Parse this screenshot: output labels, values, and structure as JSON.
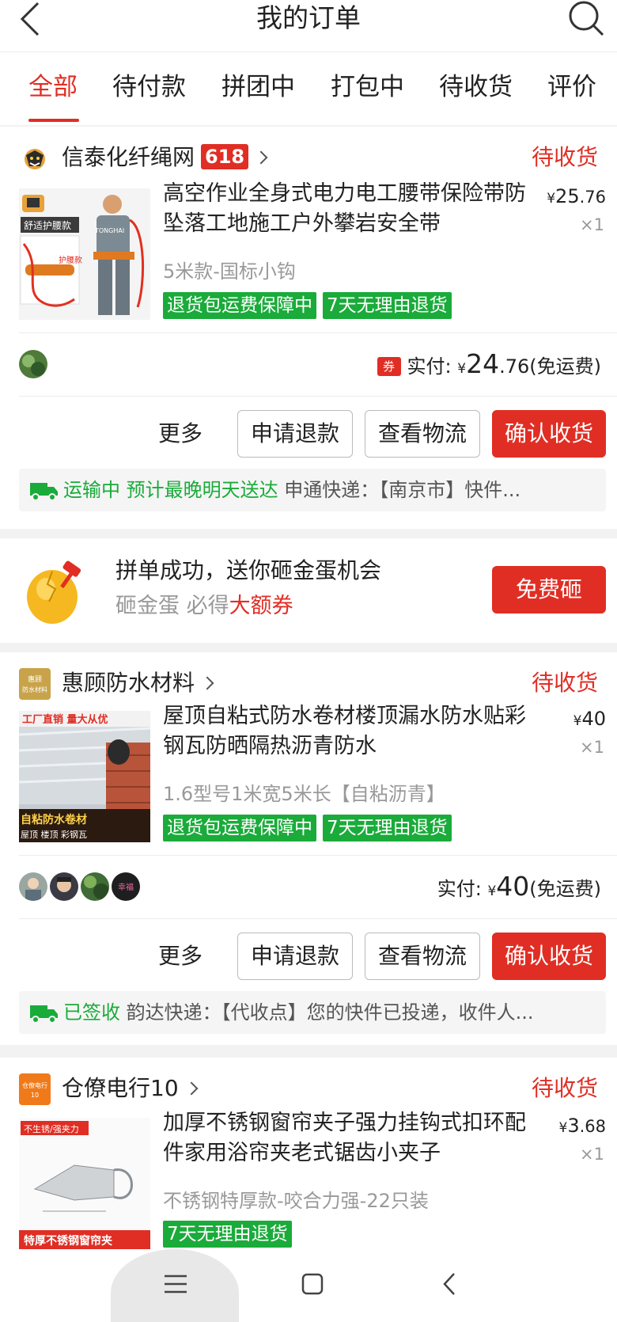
{
  "header": {
    "title": "我的订单"
  },
  "tabs": [
    {
      "label": "全部",
      "active": true
    },
    {
      "label": "待付款"
    },
    {
      "label": "拼团中"
    },
    {
      "label": "打包中"
    },
    {
      "label": "待收货"
    },
    {
      "label": "评价"
    }
  ],
  "orders": [
    {
      "shop": "信泰化纤绳网",
      "badge": "618",
      "status": "待收货",
      "title": "高空作业全身式电力电工腰带保险带防坠落工地施工户外攀岩安全带",
      "price_int": "25",
      "price_dec": ".76",
      "qty": "×1",
      "spec": "5米款-国标小钩",
      "tags": [
        "退货包运费保障中",
        "7天无理由退货"
      ],
      "thumb_text": {
        "top": "舒适护腰款",
        "mid": "护腰款",
        "brand": "TONGHAI"
      },
      "coupon": "券",
      "paid_label": "实付: ",
      "paid_int": "24",
      "paid_dec": ".76",
      "shipping": "(免运费)",
      "actions": {
        "more": "更多",
        "refund": "申请退款",
        "logistics": "查看物流",
        "confirm": "确认收货"
      },
      "log_status": "运输中 预计最晚明天送达",
      "log_detail": "申通快递：【南京市】快件..."
    },
    {
      "shop": "惠顾防水材料",
      "logo_text": "惠顾 防水材料",
      "status": "待收货",
      "title": "屋顶自粘式防水卷材楼顶漏水防水贴彩钢瓦防晒隔热沥青防水",
      "price_int": "40",
      "price_dec": "",
      "qty": "×1",
      "spec": "1.6型号1米宽5米长【自粘沥青】",
      "tags": [
        "退货包运费保障中",
        "7天无理由退货"
      ],
      "thumb_text": {
        "top": "工厂直销 量大从优",
        "mid": "自粘防水卷材",
        "bottom": "屋顶  楼顶  彩钢瓦"
      },
      "avatar_text": "幸福",
      "paid_label": "实付: ",
      "paid_int": "40",
      "paid_dec": "",
      "shipping": "(免运费)",
      "actions": {
        "more": "更多",
        "refund": "申请退款",
        "logistics": "查看物流",
        "confirm": "确认收货"
      },
      "log_status": "已签收",
      "log_detail": "韵达快递：【代收点】您的快件已投递，收件人..."
    },
    {
      "shop": "仓僚电行10",
      "logo_text": "仓僚电行 10",
      "status": "待收货",
      "title": "加厚不锈钢窗帘夹子强力挂钩式扣环配件家用浴帘夹老式锯齿小夹子",
      "price_int": "3",
      "price_dec": ".68",
      "qty": "×1",
      "spec": "不锈钢特厚款-咬合力强-22只装",
      "tags": [
        "7天无理由退货"
      ],
      "thumb_text": {
        "top": "不生锈/强夹力",
        "bottom": "特厚不锈钢窗帘夹"
      }
    }
  ],
  "promo": {
    "title": "拼单成功，送你砸金蛋机会",
    "sub_prefix": "砸金蛋 必得",
    "sub_highlight": "大额券",
    "button": "免费砸"
  },
  "colors": {
    "accent": "#e02e24",
    "green": "#1aab3a",
    "muted": "#999999"
  }
}
